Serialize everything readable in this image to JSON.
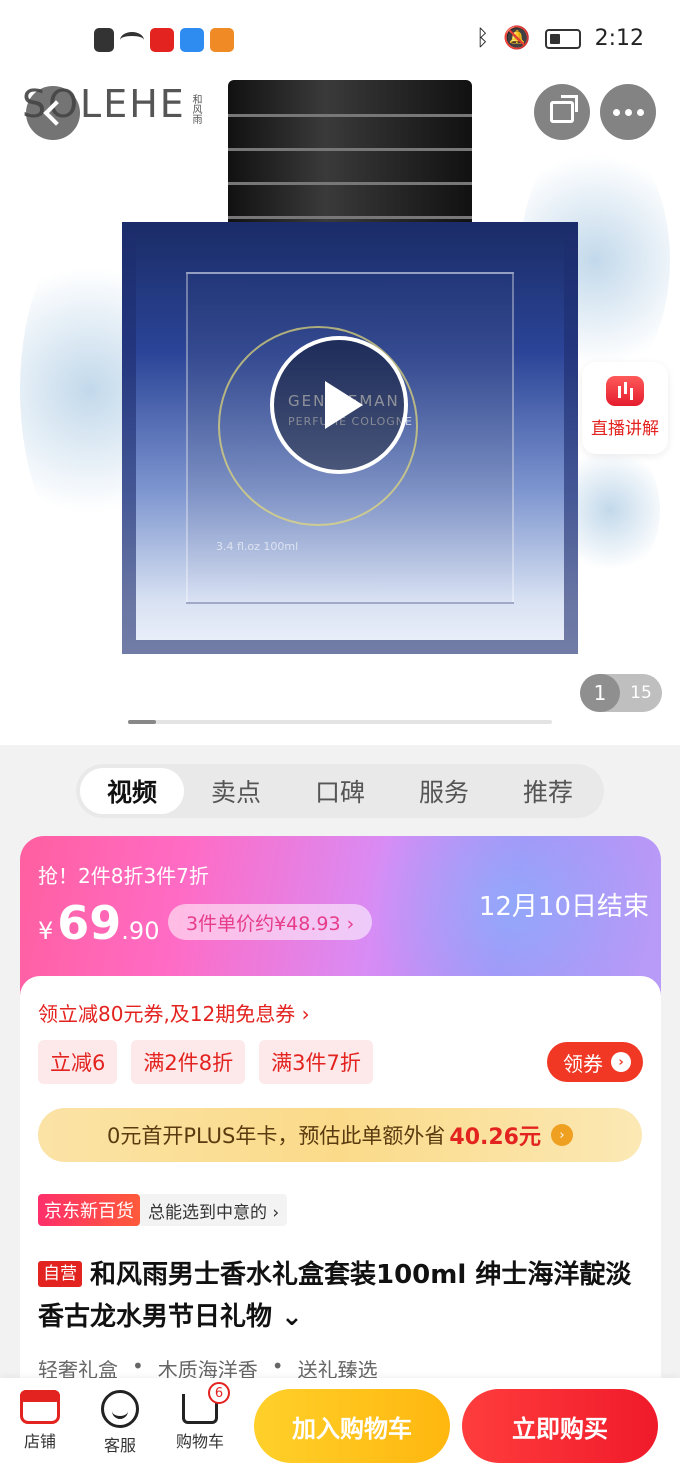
{
  "status_bar": {
    "time": "2:12"
  },
  "product_image": {
    "brand_logo": "SOLEHE",
    "brand_small": "和风雨",
    "bottle_text": "GENTLEMAN",
    "bottle_subtext": "PERFUME COLOGNE",
    "bottle_volume": "3.4 fl.oz  100ml",
    "live_label": "直播讲解",
    "page_current": "1",
    "page_total": "15",
    "image_progress": 0.066
  },
  "tabs": [
    {
      "label": "视频",
      "active": true
    },
    {
      "label": "卖点",
      "active": false
    },
    {
      "label": "口碑",
      "active": false
    },
    {
      "label": "服务",
      "active": false
    },
    {
      "label": "推荐",
      "active": false
    }
  ],
  "promo": {
    "deal_text": "抢！2件8折3件7折",
    "currency": "¥",
    "price_int": "69",
    "price_dec": ".90",
    "unit_price_text": "3件单价约¥48.93 ›",
    "end_date": "12月10日结束"
  },
  "coupons": {
    "line_text": "领立减80元券,及12期免息券 ›",
    "chips": [
      "立减6",
      "满2件8折",
      "满3件7折"
    ],
    "claim_label": "领券"
  },
  "plus_banner": {
    "text": "0元首开PLUS年卡，预估此单额外省",
    "amount": "40.26元"
  },
  "channel": {
    "tag": "京东新百货",
    "text": "总能选到中意的 ›"
  },
  "product": {
    "self_tag": "自营",
    "title": "和风雨男士香水礼盒套装100ml 绅士海洋靛淡香古龙水男节日礼物 ⌄",
    "features": [
      "轻奢礼盒",
      "•",
      "木质海洋香",
      "•",
      "送礼臻选"
    ]
  },
  "bottom_bar": {
    "store_label": "店铺",
    "service_label": "客服",
    "cart_label": "购物车",
    "cart_count": "6",
    "add_to_cart": "加入购物车",
    "buy_now": "立即购买"
  },
  "colors": {
    "accent_red": "#e3231f",
    "cart_yellow": "#ffc21c",
    "promo_pink": "#ff6bc4"
  }
}
